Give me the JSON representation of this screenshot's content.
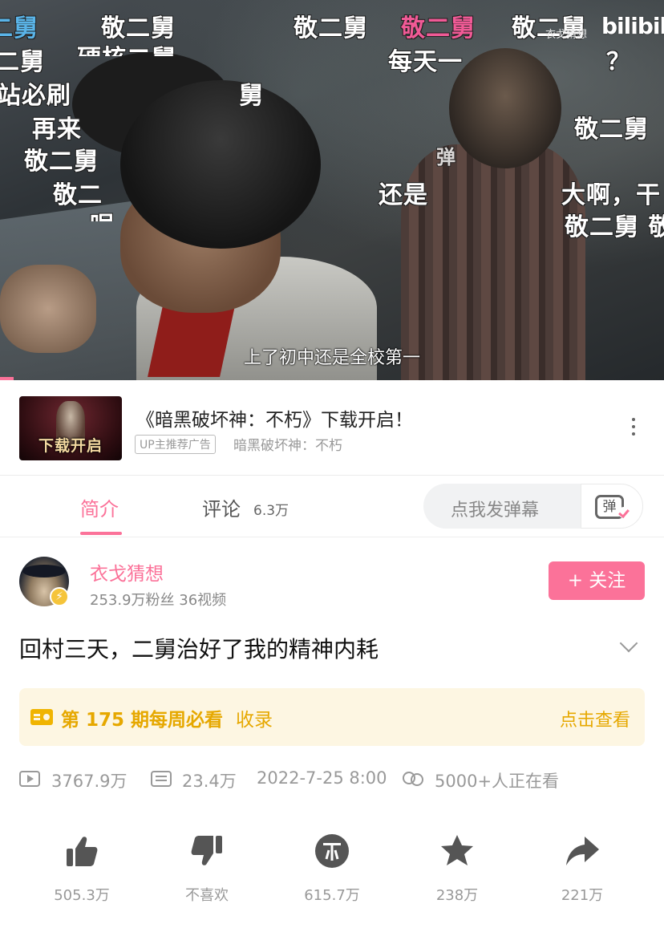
{
  "video": {
    "danmaku": [
      {
        "text": "二舅",
        "color": "#5ab4e8"
      },
      {
        "text": "敬二舅",
        "color": "#ffffff"
      },
      {
        "text": "敬二舅",
        "color": "#ffffff"
      },
      {
        "text": "敬二舅",
        "color": "#f05a96"
      },
      {
        "text": "敬二舅",
        "color": "#ffffff"
      },
      {
        "text": "二舅",
        "color": "#ffffff"
      },
      {
        "text": "硬核二舅",
        "color": "#ffffff"
      },
      {
        "text": "每天一",
        "color": "#ffffff"
      },
      {
        "text": "？",
        "color": "#ffffff"
      },
      {
        "text": "站必刷",
        "color": "#ffffff"
      },
      {
        "text": "舅",
        "color": "#ffffff"
      },
      {
        "text": "再来",
        "color": "#ffffff"
      },
      {
        "text": "敬二舅",
        "color": "#ffffff"
      },
      {
        "text": "敬二舅",
        "color": "#ffffff"
      },
      {
        "text": "弹",
        "color": "#ffffff"
      },
      {
        "text": "敬二",
        "color": "#ffffff"
      },
      {
        "text": "还是",
        "color": "#ffffff"
      },
      {
        "text": "大啊，干",
        "color": "#ffffff"
      },
      {
        "text": "呢",
        "color": "#ffffff"
      },
      {
        "text": "敬二舅 敬",
        "color": "#ffffff"
      }
    ],
    "watermark": "衣戈猜想",
    "logo": "bilibili",
    "subtitle": "上了初中还是全校第一",
    "progress": 0.02
  },
  "ad": {
    "thumb_label": "下载开启",
    "title": "《暗黑破坏神：不朽》下载开启！",
    "badge": "UP主推荐广告",
    "subtitle": "暗黑破坏神：不朽"
  },
  "tabs": {
    "intro": "简介",
    "comment": "评论",
    "comment_count": "6.3万",
    "danmaku_placeholder": "点我发弹幕",
    "danmaku_button": "弹"
  },
  "uploader": {
    "name": "衣戈猜想",
    "meta": "253.9万粉丝   36视频",
    "follow": "+ 关注"
  },
  "title": "回村三天，二舅治好了我的精神内耗",
  "weekly": {
    "text": "第 175 期每周必看",
    "tag": "收录",
    "link": "点击查看"
  },
  "stats": {
    "plays": "3767.9万",
    "danmaku": "23.4万",
    "date": "2022-7-25 8:00",
    "watching": "5000+人正在看"
  },
  "actions": {
    "like": "505.3万",
    "dislike": "不喜欢",
    "coin": "615.7万",
    "favorite": "238万",
    "share": "221万"
  },
  "colors": {
    "brand_pink": "#fb7299",
    "weekly_gold": "#e6a800",
    "icon_gray": "#555555"
  }
}
